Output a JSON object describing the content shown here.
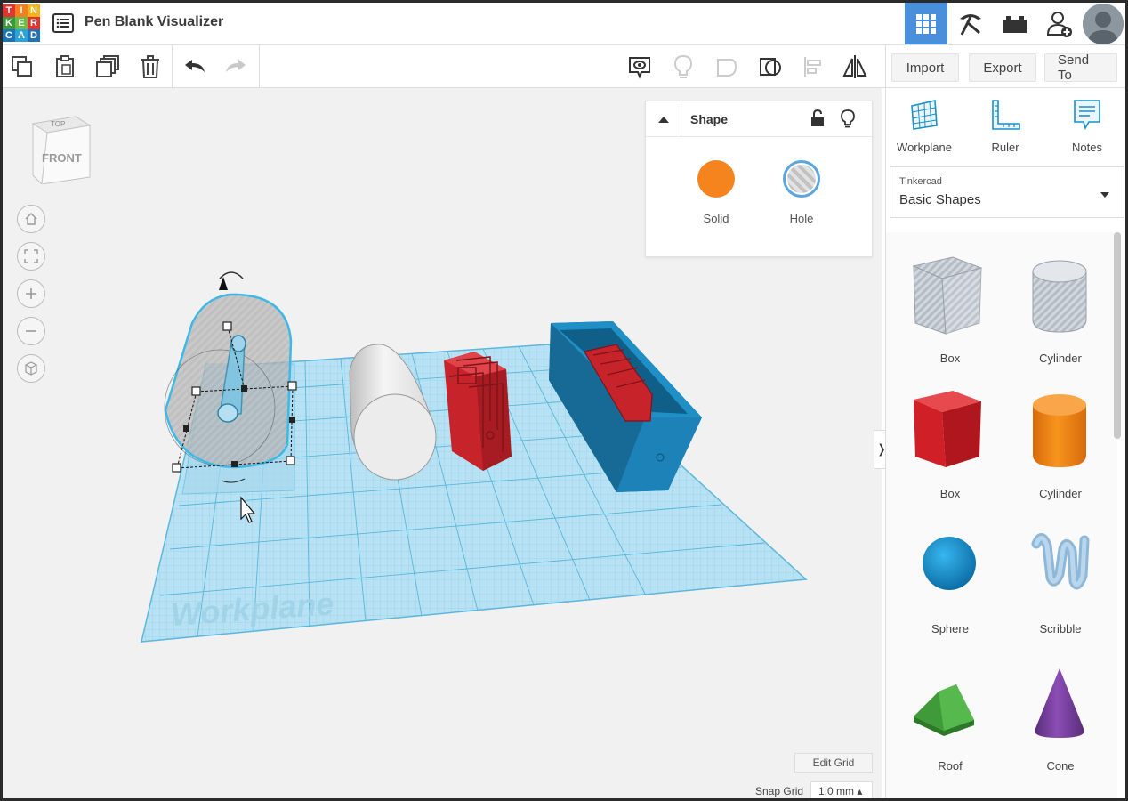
{
  "app": {
    "logo_letters": [
      "T",
      "I",
      "N",
      "K",
      "E",
      "R",
      "C",
      "A",
      "D"
    ],
    "logo_colors": [
      "#e5322d",
      "#f27f21",
      "#f6b513",
      "#3a9a3a",
      "#67bd45",
      "#e5322d",
      "#1e72b7",
      "#2ba3d8",
      "#1e72b7"
    ],
    "document_title": "Pen Blank Visualizer"
  },
  "header": {
    "icons": [
      "grid-view-icon",
      "pickaxe-icon",
      "bricks-icon",
      "add-user-icon"
    ],
    "active_color": "#4a8fdc"
  },
  "toolbar": {
    "import_label": "Import",
    "export_label": "Export",
    "send_to_label": "Send To"
  },
  "viewcube": {
    "top_label": "TOP",
    "front_label": "FRONT"
  },
  "workplane": {
    "watermark": "Workplane"
  },
  "inspector": {
    "title": "Shape",
    "solid_label": "Solid",
    "hole_label": "Hole",
    "solid_color": "#f5841f"
  },
  "right_panel": {
    "tools": [
      {
        "label": "Workplane",
        "icon": "workplane-icon"
      },
      {
        "label": "Ruler",
        "icon": "ruler-icon"
      },
      {
        "label": "Notes",
        "icon": "notes-icon"
      }
    ],
    "library_provider": "Tinkercad",
    "library_name": "Basic Shapes",
    "shapes": [
      {
        "label": "Box",
        "icon": "box-hole-icon"
      },
      {
        "label": "Cylinder",
        "icon": "cylinder-hole-icon"
      },
      {
        "label": "Box",
        "icon": "box-icon"
      },
      {
        "label": "Cylinder",
        "icon": "cylinder-icon"
      },
      {
        "label": "Sphere",
        "icon": "sphere-icon"
      },
      {
        "label": "Scribble",
        "icon": "scribble-icon"
      },
      {
        "label": "Roof",
        "icon": "roof-icon"
      },
      {
        "label": "Cone",
        "icon": "cone-icon"
      }
    ]
  },
  "grid": {
    "edit_grid_label": "Edit Grid",
    "snap_grid_label": "Snap Grid",
    "snap_value": "1.0 mm ▴"
  }
}
